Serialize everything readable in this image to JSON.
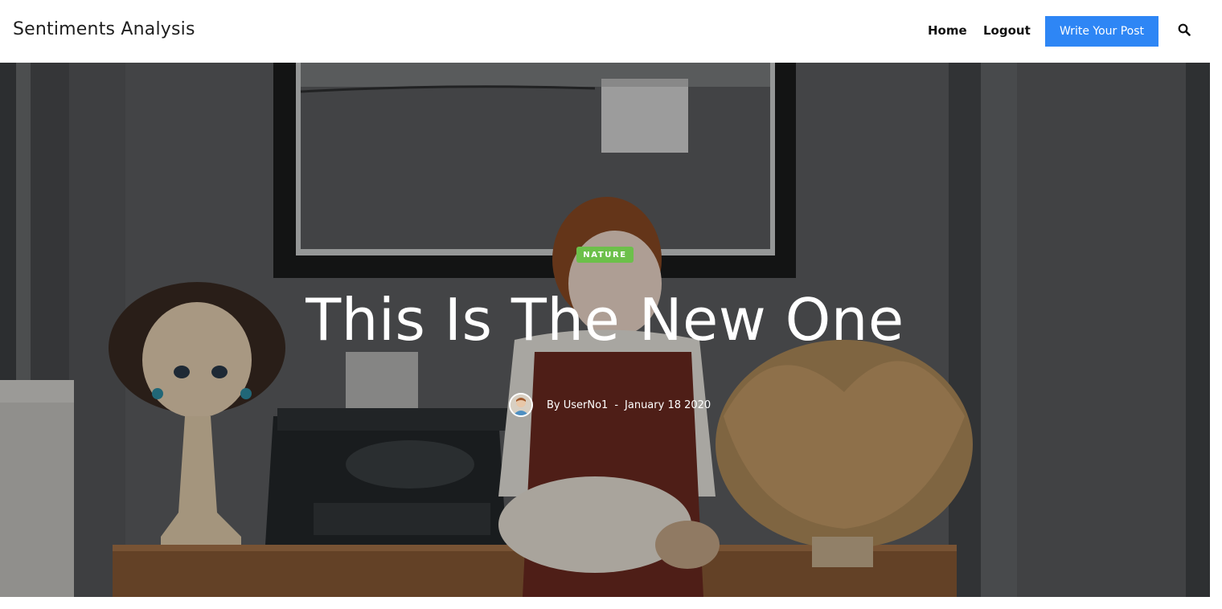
{
  "header": {
    "brand": "Sentiments Analysis",
    "nav": {
      "home": "Home",
      "logout": "Logout",
      "write_post": "Write Your Post"
    },
    "search_icon": "search-icon"
  },
  "hero": {
    "category": "NATURE",
    "title": "This Is The New One",
    "author": "By UserNo1",
    "separator": "-",
    "date": "January 18 2020",
    "avatar_icon": "author-avatar"
  },
  "colors": {
    "accent": "#2e86f5",
    "category": "#6cc04a"
  }
}
